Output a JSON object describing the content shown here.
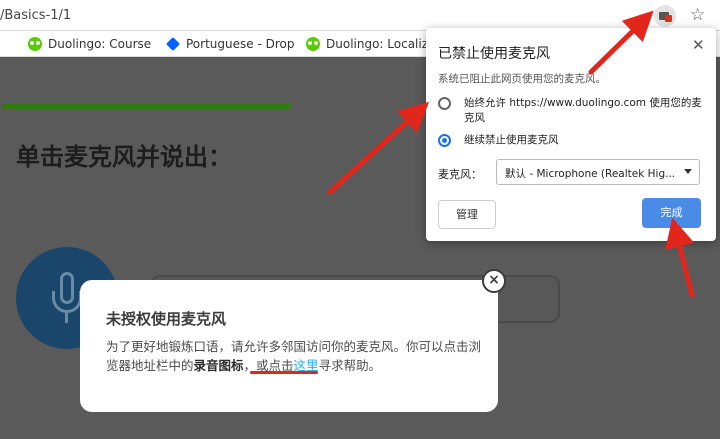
{
  "browser": {
    "url": "/Basics-1/1",
    "bookmarks": [
      {
        "label": "Duolingo: Course Edi",
        "icon": "duolingo-owl-icon"
      },
      {
        "label": "Portuguese - Dropbo",
        "icon": "dropbox-icon"
      },
      {
        "label": "Duolingo: Localizati",
        "icon": "duolingo-owl-icon"
      }
    ],
    "star_icon": "☆"
  },
  "page": {
    "prompt": "单击麦克风并说出："
  },
  "popup": {
    "title": "已禁止使用麦克风",
    "close": "✕",
    "subtitle": "系统已阻止此网页使用您的麦克风。",
    "option_allow_line1": "始终允许 https://www.duolingo.com 使用您的麦",
    "option_allow_line2": "克风",
    "option_block": "继续禁止使用麦克风",
    "mic_label": "麦克风：",
    "mic_select": "默认 - Microphone (Realtek Hig...",
    "manage_button": "管理",
    "done_button": "完成"
  },
  "dialog": {
    "title": "未授权使用麦克风",
    "body_part1": "为了更好地锻炼口语，请允许多邻国访问你的麦克风。你可以点击浏览器地址栏中的",
    "body_bold": "录音图标",
    "body_part2": "，或点击",
    "body_link": "这里",
    "body_part3": "寻求帮助。",
    "close": "×"
  },
  "colors": {
    "accent_blue": "#4a8be8",
    "annotation_red": "#e3261c",
    "link_blue": "#1cb0f6"
  }
}
